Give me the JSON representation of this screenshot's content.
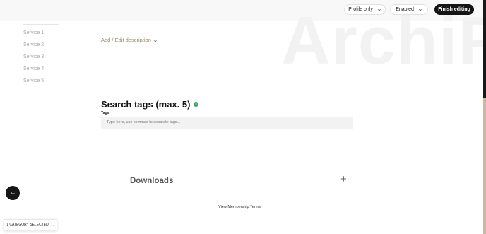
{
  "header": {
    "watermark": "ArchiP",
    "visibility_select": "Profile only",
    "status_select": "Enabled",
    "finish_button": "Finish editing"
  },
  "sidebar": {
    "items": [
      "Service 1",
      "Service 2",
      "Service 3",
      "Service 4",
      "Service 5"
    ]
  },
  "description": {
    "toggle_label": "Add / Edit description"
  },
  "search_tags": {
    "title": "Search tags (max. 5)",
    "info_icon": "i",
    "field_label": "Tags",
    "placeholder": "Type here, use commas to separate tags..."
  },
  "downloads": {
    "title": "Downloads",
    "add_icon": "+"
  },
  "footer": {
    "terms_link": "View Membership Terms"
  },
  "category": {
    "label": "1 CATEGORY SELECTED"
  },
  "icons": {
    "chevron": "chevron-down-icon",
    "back": "arrow-left-icon",
    "info": "info-icon",
    "add": "plus-icon"
  },
  "colors": {
    "primary_dark": "#141414",
    "info_green": "#3aa56a",
    "description_link": "#9b8a70"
  }
}
